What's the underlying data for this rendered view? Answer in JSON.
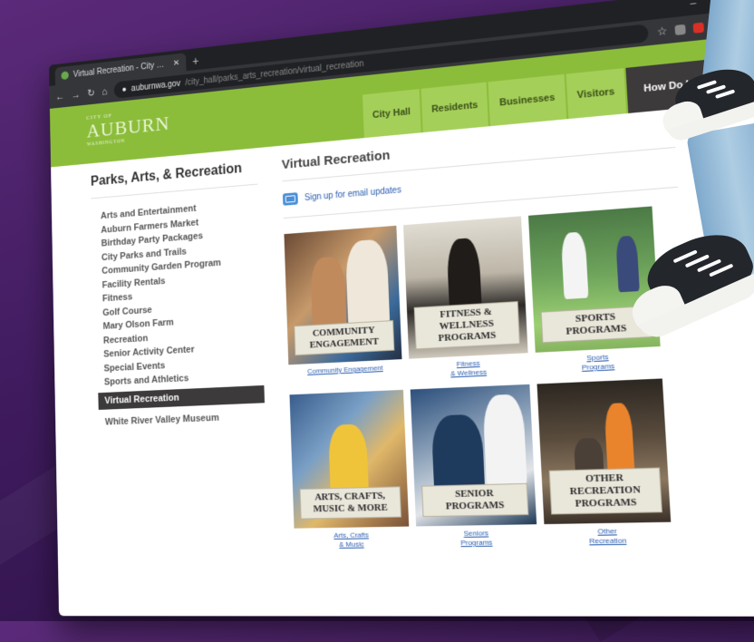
{
  "browser": {
    "tab_title": "Virtual Recreation - City of Aubu...",
    "url_host": "auburnwa.gov",
    "url_rest": "/city_hall/parks_arts_recreation/virtual_recreation"
  },
  "site": {
    "logo_small": "CITY OF",
    "logo": "AUBURN",
    "logo_sub": "WASHINGTON",
    "nav": [
      "City Hall",
      "Residents",
      "Businesses",
      "Visitors"
    ],
    "nav_how": "How Do I...",
    "sidebar_title": "Parks, Arts, & Recreation",
    "sidebar_items": [
      "Arts and Entertainment",
      "Auburn Farmers Market",
      "Birthday Party Packages",
      "City Parks and Trails",
      "Community Garden Program",
      "Facility Rentals",
      "Fitness",
      "Golf Course",
      "Mary Olson Farm",
      "Recreation",
      "Senior Activity Center",
      "Special Events",
      "Sports and Athletics",
      "Virtual Recreation",
      "White River Valley Museum"
    ],
    "page_title": "Virtual Recreation",
    "signup": "Sign up for email updates",
    "cards": [
      {
        "label": "COMMUNITY\nENGAGEMENT",
        "caption": "Community Engagement"
      },
      {
        "label": "FITNESS & WELLNESS\nPROGRAMS",
        "caption": "Fitness\n& Wellness"
      },
      {
        "label": "SPORTS\nPROGRAMS",
        "caption": "Sports\nPrograms"
      },
      {
        "label": "ARTS, CRAFTS,\nMUSIC & MORE",
        "caption": "Arts, Crafts\n& Music"
      },
      {
        "label": "SENIOR\nPROGRAMS",
        "caption": "Seniors\nPrograms"
      },
      {
        "label": "OTHER RECREATION\nPROGRAMS",
        "caption": "Other\nRecreation"
      }
    ]
  },
  "colors": {
    "header_green": "#8bbd3a",
    "nav_dark": "#3c3a3b",
    "link_blue": "#2a5db0",
    "background_purple": "#4a2166"
  },
  "icons": [
    "rss-icon",
    "megaphone-icon",
    "phone-icon",
    "mail-icon",
    "star-icon"
  ]
}
